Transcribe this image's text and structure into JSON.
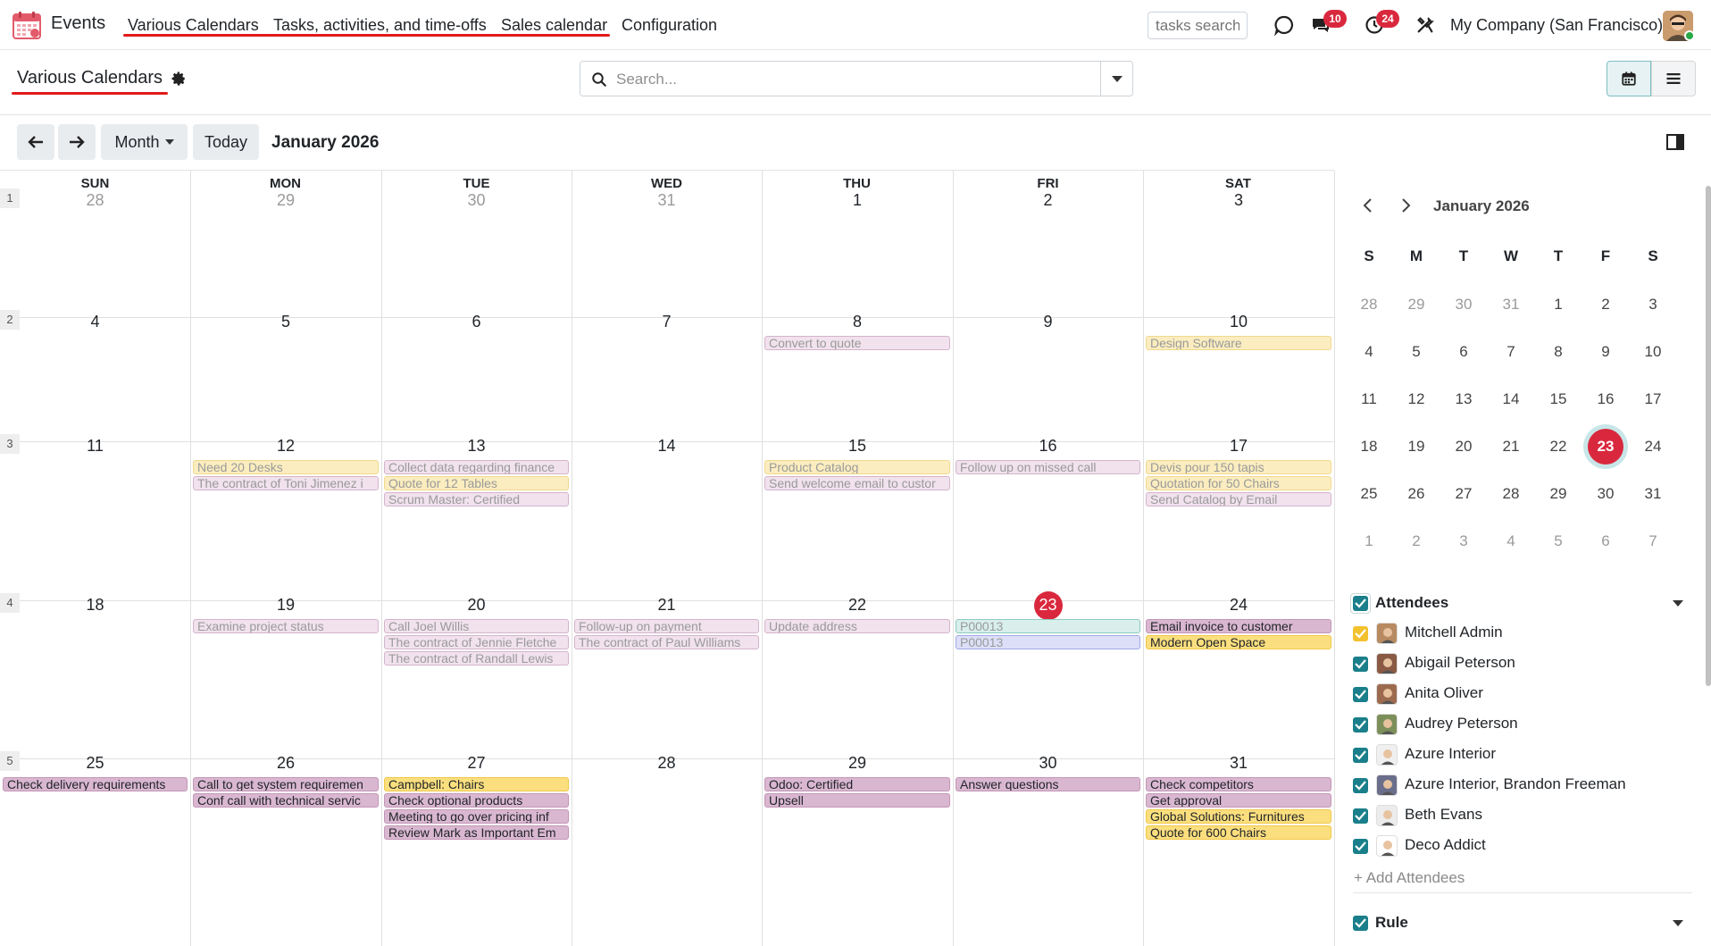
{
  "app": {
    "name": "Events"
  },
  "menu": [
    "Various Calendars",
    "Tasks, activities, and time-offs",
    "Sales calendar",
    "Configuration"
  ],
  "topbar": {
    "tasks_search_placeholder": "tasks search",
    "messages_badge": "10",
    "activities_badge": "24",
    "company": "My Company (San Francisco)"
  },
  "page": {
    "title": "Various Calendars"
  },
  "search": {
    "placeholder": "Search..."
  },
  "toolbar": {
    "scale_label": "Month",
    "today_label": "Today",
    "range_label": "January 2026"
  },
  "calendar": {
    "weekdays": [
      "SUN",
      "MON",
      "TUE",
      "WED",
      "THU",
      "FRI",
      "SAT"
    ],
    "week_numbers": [
      "1",
      "2",
      "3",
      "4",
      "5"
    ],
    "weeks": [
      [
        {
          "d": "28",
          "m": true
        },
        {
          "d": "29",
          "m": true
        },
        {
          "d": "30",
          "m": true
        },
        {
          "d": "31",
          "m": true
        },
        {
          "d": "1"
        },
        {
          "d": "2"
        },
        {
          "d": "3"
        }
      ],
      [
        {
          "d": "4"
        },
        {
          "d": "5"
        },
        {
          "d": "6"
        },
        {
          "d": "7"
        },
        {
          "d": "8"
        },
        {
          "d": "9"
        },
        {
          "d": "10"
        }
      ],
      [
        {
          "d": "11"
        },
        {
          "d": "12"
        },
        {
          "d": "13"
        },
        {
          "d": "14"
        },
        {
          "d": "15"
        },
        {
          "d": "16"
        },
        {
          "d": "17"
        }
      ],
      [
        {
          "d": "18"
        },
        {
          "d": "19"
        },
        {
          "d": "20"
        },
        {
          "d": "21"
        },
        {
          "d": "22"
        },
        {
          "d": "23",
          "today": true
        },
        {
          "d": "24"
        }
      ],
      [
        {
          "d": "25"
        },
        {
          "d": "26"
        },
        {
          "d": "27"
        },
        {
          "d": "28"
        },
        {
          "d": "29"
        },
        {
          "d": "30"
        },
        {
          "d": "31"
        }
      ]
    ],
    "events": [
      {
        "w": 1,
        "c": 4,
        "r": 0,
        "t": "Convert to quote",
        "s": "p"
      },
      {
        "w": 1,
        "c": 6,
        "r": 0,
        "t": "Design Software",
        "s": "y"
      },
      {
        "w": 2,
        "c": 1,
        "r": 0,
        "t": "Need 20 Desks",
        "s": "y"
      },
      {
        "w": 2,
        "c": 1,
        "r": 1,
        "t": "The contract of Toni Jimenez i",
        "s": "p"
      },
      {
        "w": 2,
        "c": 2,
        "r": 0,
        "t": "Collect data regarding finance",
        "s": "p"
      },
      {
        "w": 2,
        "c": 2,
        "r": 1,
        "t": "Quote for 12 Tables",
        "s": "y"
      },
      {
        "w": 2,
        "c": 2,
        "r": 2,
        "t": "Scrum Master: Certified",
        "s": "p"
      },
      {
        "w": 2,
        "c": 4,
        "r": 0,
        "t": "Product Catalog",
        "s": "y"
      },
      {
        "w": 2,
        "c": 4,
        "r": 1,
        "t": "Send welcome email to custor",
        "s": "p"
      },
      {
        "w": 2,
        "c": 5,
        "r": 0,
        "t": "Follow up on missed call",
        "s": "p"
      },
      {
        "w": 2,
        "c": 6,
        "r": 0,
        "t": "Devis pour 150 tapis",
        "s": "y"
      },
      {
        "w": 2,
        "c": 6,
        "r": 1,
        "t": "Quotation for 50 Chairs",
        "s": "y"
      },
      {
        "w": 2,
        "c": 6,
        "r": 2,
        "t": "Send Catalog by Email",
        "s": "p"
      },
      {
        "w": 3,
        "c": 1,
        "r": 0,
        "t": "Examine project status",
        "s": "p"
      },
      {
        "w": 3,
        "c": 2,
        "r": 0,
        "t": "Call Joel Willis",
        "s": "p"
      },
      {
        "w": 3,
        "c": 2,
        "r": 1,
        "t": "The contract of Jennie Fletche",
        "s": "p"
      },
      {
        "w": 3,
        "c": 2,
        "r": 2,
        "t": "The contract of Randall Lewis",
        "s": "p"
      },
      {
        "w": 3,
        "c": 3,
        "r": 0,
        "t": "Follow-up on payment",
        "s": "p"
      },
      {
        "w": 3,
        "c": 3,
        "r": 1,
        "t": "The contract of Paul Williams",
        "s": "p"
      },
      {
        "w": 3,
        "c": 4,
        "r": 0,
        "t": "Update address",
        "s": "p"
      },
      {
        "w": 3,
        "c": 5,
        "r": 0,
        "t": "P00013",
        "s": "g"
      },
      {
        "w": 3,
        "c": 5,
        "r": 1,
        "t": "P00013",
        "s": "b"
      },
      {
        "w": 3,
        "c": 6,
        "r": 0,
        "t": "Email invoice to customer",
        "s": "P"
      },
      {
        "w": 3,
        "c": 6,
        "r": 1,
        "t": "Modern Open Space",
        "s": "Y"
      },
      {
        "w": 4,
        "c": 0,
        "r": 0,
        "t": "Check delivery requirements",
        "s": "P"
      },
      {
        "w": 4,
        "c": 1,
        "r": 0,
        "t": "Call to get system requiremen",
        "s": "P"
      },
      {
        "w": 4,
        "c": 1,
        "r": 1,
        "t": "Conf call with technical servic",
        "s": "P"
      },
      {
        "w": 4,
        "c": 2,
        "r": 0,
        "t": "Campbell: Chairs",
        "s": "Y"
      },
      {
        "w": 4,
        "c": 2,
        "r": 1,
        "t": "Check optional products",
        "s": "P"
      },
      {
        "w": 4,
        "c": 2,
        "r": 2,
        "t": "Meeting to go over pricing inf",
        "s": "P"
      },
      {
        "w": 4,
        "c": 2,
        "r": 3,
        "t": "Review Mark as Important Em",
        "s": "P"
      },
      {
        "w": 4,
        "c": 4,
        "r": 0,
        "t": "Odoo: Certified",
        "s": "P"
      },
      {
        "w": 4,
        "c": 4,
        "r": 1,
        "t": "Upsell",
        "s": "P"
      },
      {
        "w": 4,
        "c": 5,
        "r": 0,
        "t": "Answer questions",
        "s": "P"
      },
      {
        "w": 4,
        "c": 6,
        "r": 0,
        "t": "Check competitors",
        "s": "P"
      },
      {
        "w": 4,
        "c": 6,
        "r": 1,
        "t": "Get approval",
        "s": "P"
      },
      {
        "w": 4,
        "c": 6,
        "r": 2,
        "t": "Global Solutions: Furnitures",
        "s": "Y"
      },
      {
        "w": 4,
        "c": 6,
        "r": 3,
        "t": "Quote for 600 Chairs",
        "s": "Y"
      }
    ]
  },
  "mini_calendar": {
    "title": "January 2026",
    "weekdays": [
      "S",
      "M",
      "T",
      "W",
      "T",
      "F",
      "S"
    ],
    "days": [
      [
        "28",
        "29",
        "30",
        "31",
        "1",
        "2",
        "3"
      ],
      [
        "4",
        "5",
        "6",
        "7",
        "8",
        "9",
        "10"
      ],
      [
        "11",
        "12",
        "13",
        "14",
        "15",
        "16",
        "17"
      ],
      [
        "18",
        "19",
        "20",
        "21",
        "22",
        "23",
        "24"
      ],
      [
        "25",
        "26",
        "27",
        "28",
        "29",
        "30",
        "31"
      ],
      [
        "1",
        "2",
        "3",
        "4",
        "5",
        "6",
        "7"
      ]
    ],
    "today": "23"
  },
  "filters": {
    "attendees_title": "Attendees",
    "attendees": [
      "Mitchell Admin",
      "Abigail Peterson",
      "Anita Oliver",
      "Audrey Peterson",
      "Azure Interior",
      "Azure Interior, Brandon Freeman",
      "Beth Evans",
      "Deco Addict"
    ],
    "add_attendees": "+ Add Attendees",
    "rule_title": "Rule"
  }
}
